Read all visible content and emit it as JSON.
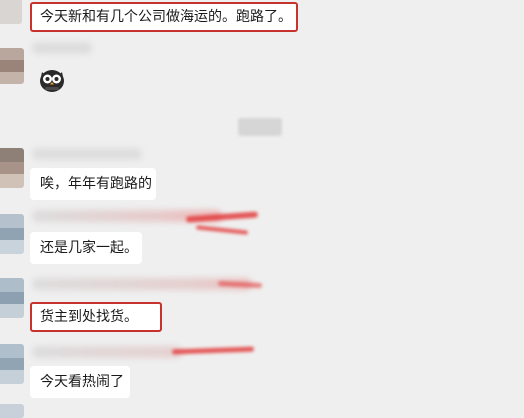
{
  "messages": [
    {
      "text": "今天新和有几个公司做海运的。跑路了。",
      "highlighted": true
    },
    {
      "sticker": "owl-sticker-icon"
    },
    {
      "text": "唉，年年有跑路的",
      "highlighted": false
    },
    {
      "text": "还是几家一起。",
      "highlighted": false
    },
    {
      "text": "货主到处找货。",
      "highlighted": true
    },
    {
      "text": "今天看热闹了",
      "highlighted": false
    }
  ],
  "colors": {
    "background": "#efefef",
    "bubble": "#ffffff",
    "highlight_border": "#c8322c",
    "redaction": "#e23c3c"
  }
}
